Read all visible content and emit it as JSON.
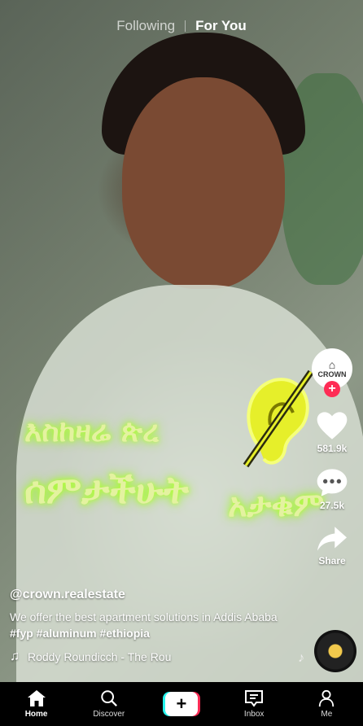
{
  "top_tabs": {
    "following": "Following",
    "for_you": "For You"
  },
  "video_overlay": {
    "line1": "እስከዛሬ ጵረ",
    "line2": "ሰምታችሁት",
    "line3": "አታቁም"
  },
  "right_rail": {
    "avatar_brand": "CROWN",
    "likes": "581.9k",
    "comments": "27.5k",
    "share_label": "Share"
  },
  "caption": {
    "handle": "@crown.realestate",
    "description": "We offer the best apartment solutions in Addis Ababa",
    "hashtags": "#fyp #aluminum #ethiopia",
    "music": "Roddy Roundicch - The Rou"
  },
  "bottom_nav": {
    "home": "Home",
    "discover": "Discover",
    "create": "+",
    "inbox": "Inbox",
    "me": "Me"
  },
  "colors": {
    "accent_red": "#fe2c55",
    "accent_cyan": "#25f4ee",
    "overlay_glow": "#b5ff3a"
  }
}
